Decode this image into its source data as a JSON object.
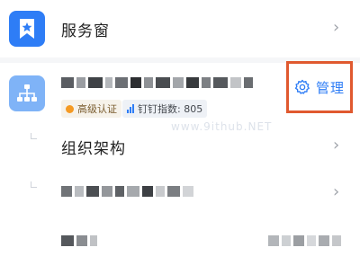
{
  "service_window": {
    "title": "服务窗",
    "icon": "bookmark-star-icon",
    "chevron": "›"
  },
  "organization": {
    "icon": "org-chart-icon",
    "badges": {
      "certification": "高级认证",
      "index": "钉钉指数: 805"
    },
    "manage": {
      "icon": "gear-icon",
      "label": "管理"
    }
  },
  "rows": [
    {
      "title": "组织架构",
      "chevron": "›"
    },
    {
      "chevron": "›"
    }
  ],
  "watermark": "www.9ithub.NET",
  "colors": {
    "accent": "#2e7df6",
    "highlight_border": "#e0592f",
    "cert_dot": "#f59a23"
  }
}
